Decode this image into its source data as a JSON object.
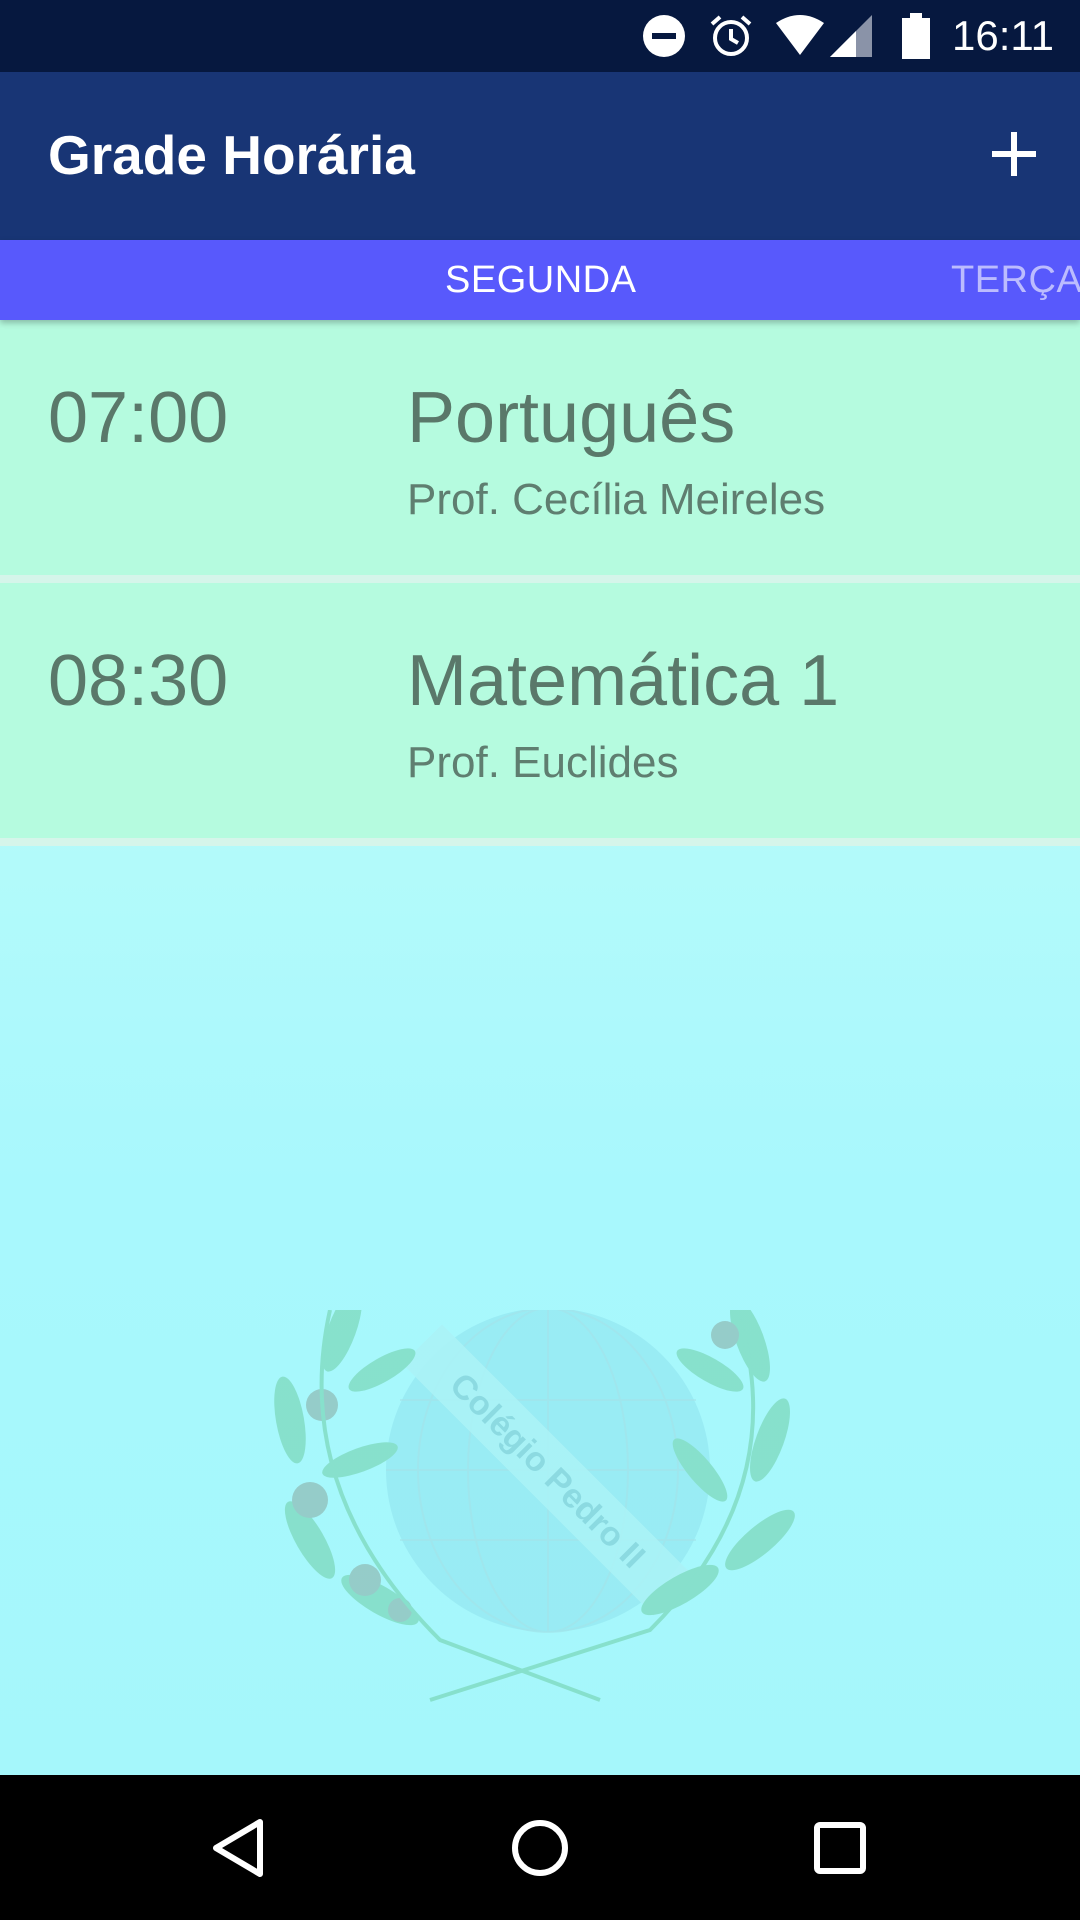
{
  "status_bar": {
    "time": "16:11",
    "icons": [
      "do-not-disturb-icon",
      "alarm-icon",
      "wifi-icon",
      "cell-signal-icon",
      "battery-icon"
    ]
  },
  "app_bar": {
    "title": "Grade Horária",
    "add_icon": "plus-icon"
  },
  "tabs": [
    {
      "label": "SEGUNDA",
      "active": true
    },
    {
      "label": "TERÇA",
      "active": false
    }
  ],
  "entries": [
    {
      "time": "07:00",
      "subject": "Português",
      "teacher": "Prof. Cecília Meireles"
    },
    {
      "time": "08:30",
      "subject": "Matemática 1",
      "teacher": "Prof. Euclides"
    }
  ],
  "watermark": {
    "text": "Colégio Pedro II"
  },
  "nav_bar": {
    "icons": [
      "back-icon",
      "home-icon",
      "recents-icon"
    ]
  },
  "colors": {
    "status_bar": "#06183f",
    "app_bar": "#183575",
    "tab_bar": "#5859fc",
    "entry_background": "#b5fbdf",
    "content_background": "#a9fafc",
    "text_secondary": "#5a786a"
  }
}
